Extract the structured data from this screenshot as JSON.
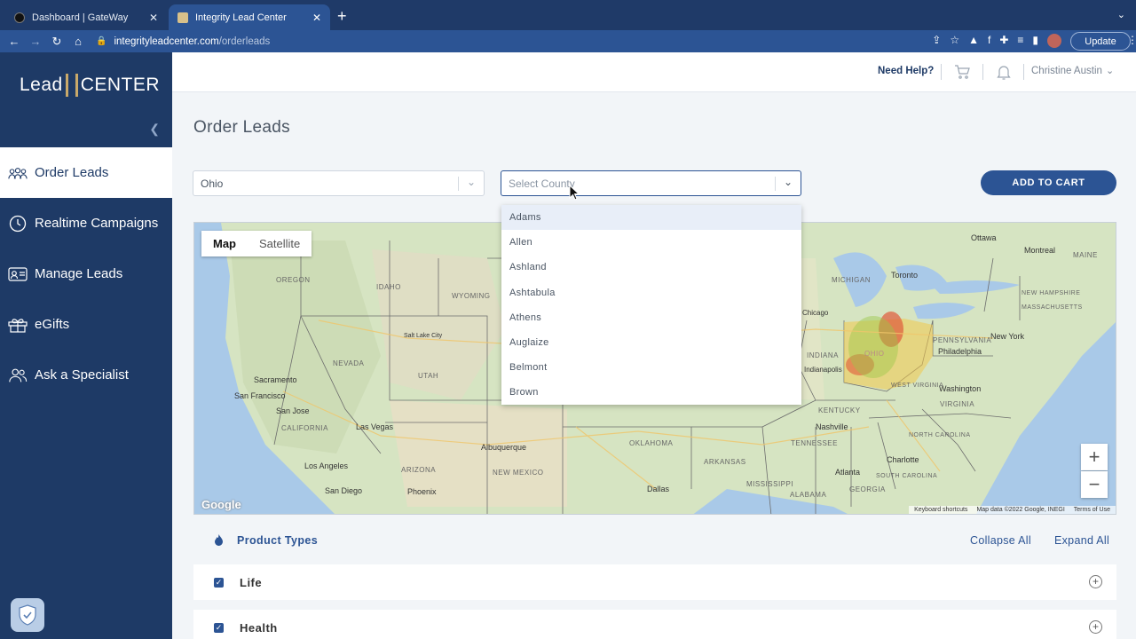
{
  "browser": {
    "tabs": [
      {
        "title": "Dashboard | GateWay",
        "active": false
      },
      {
        "title": "Integrity Lead Center",
        "active": true
      }
    ],
    "url_host": "integrityleadcenter.com",
    "url_path": "/orderleads",
    "update_label": "Update"
  },
  "sidebar": {
    "logo_left": "Lead",
    "logo_right": "CENTER",
    "items": [
      {
        "label": "Order Leads",
        "icon": "people-group-icon",
        "active": true
      },
      {
        "label": "Realtime Campaigns",
        "icon": "clock-icon",
        "active": false
      },
      {
        "label": "Manage Leads",
        "icon": "contact-card-icon",
        "active": false
      },
      {
        "label": "eGifts",
        "icon": "gift-icon",
        "active": false
      },
      {
        "label": "Ask a Specialist",
        "icon": "users-icon",
        "active": false
      }
    ]
  },
  "header": {
    "help_label": "Need Help?",
    "user_name": "Christine Austin"
  },
  "page": {
    "title": "Order Leads",
    "state_value": "Ohio",
    "county_placeholder": "Select County",
    "add_to_cart_label": "ADD TO CART"
  },
  "map": {
    "type_options": [
      "Map",
      "Satellite"
    ],
    "selected_type": "Map",
    "cities": [
      "Ottawa",
      "Montreal",
      "Toronto",
      "Sacramento",
      "San Francisco",
      "San Jose",
      "Salt Lake City",
      "Las Vegas",
      "Los Angeles",
      "San Diego",
      "Phoenix",
      "Albuquerque",
      "Dallas",
      "Indianapolis",
      "Philadelphia",
      "New York",
      "Washington",
      "Nashville",
      "Charlotte",
      "Atlanta",
      "Chicago"
    ],
    "states": [
      "OREGON",
      "IDAHO",
      "WYOMING",
      "NEVADA",
      "UTAH",
      "CALIFORNIA",
      "ARIZONA",
      "NEW MEXICO",
      "OKLAHOMA",
      "ARKANSAS",
      "MISSISSIPPI",
      "ALABAMA",
      "GEORGIA",
      "TENNESSEE",
      "KENTUCKY",
      "INDIANA",
      "OHIO",
      "PENNSYLVANIA",
      "WEST VIRGINIA",
      "VIRGINIA",
      "NORTH CAROLINA",
      "SOUTH CAROLINA",
      "MICHIGAN",
      "NEW HAMPSHIRE",
      "MASSACHUSETTS",
      "MAINE"
    ],
    "footer": [
      "Keyboard shortcuts",
      "Map data ©2022 Google, INEGI",
      "Terms of Use"
    ],
    "google_label": "Google",
    "zoom_in": "+",
    "zoom_out": "−"
  },
  "county_options": [
    "Adams",
    "Allen",
    "Ashland",
    "Ashtabula",
    "Athens",
    "Auglaize",
    "Belmont",
    "Brown"
  ],
  "highlighted_county": "Adams",
  "product_types": {
    "title": "Product Types",
    "collapse_label": "Collapse All",
    "expand_label": "Expand All",
    "items": [
      {
        "label": "Life",
        "checked": true
      },
      {
        "label": "Health",
        "checked": true
      }
    ]
  }
}
